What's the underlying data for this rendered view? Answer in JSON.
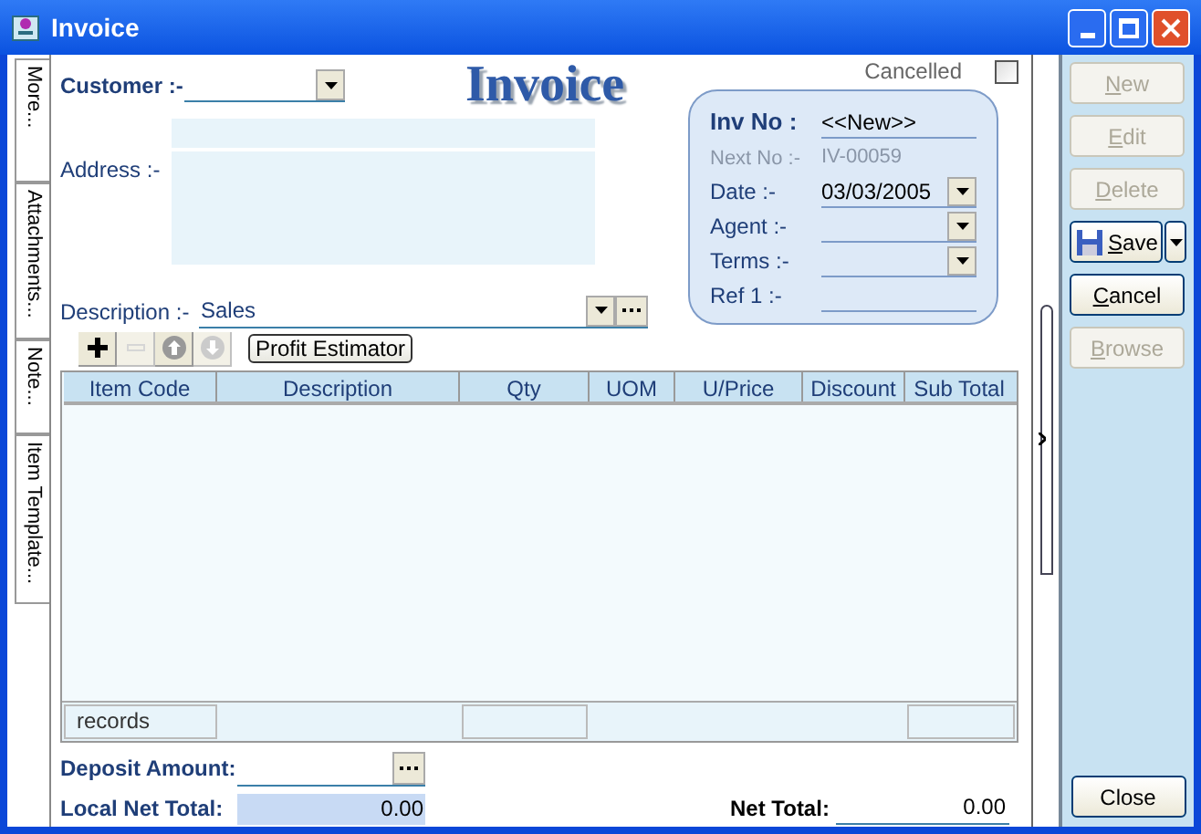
{
  "window": {
    "title": "Invoice"
  },
  "side_tabs": [
    {
      "label": "More..."
    },
    {
      "label": "Attachments..."
    },
    {
      "label": "Note..."
    },
    {
      "label": "Item Template..."
    }
  ],
  "heading": "Invoice",
  "customer": {
    "label": "Customer :-"
  },
  "address": {
    "label": "Address :-"
  },
  "description": {
    "label": "Description :-",
    "value": "Sales"
  },
  "cancelled": {
    "label": "Cancelled",
    "checked": false
  },
  "info_panel": {
    "inv_no": {
      "label": "Inv No :",
      "value": "<<New>>"
    },
    "next_no": {
      "label": "Next No :-",
      "value": "IV-00059"
    },
    "date": {
      "label": "Date :-",
      "value": "03/03/2005"
    },
    "agent": {
      "label": "Agent :-"
    },
    "terms": {
      "label": "Terms :-"
    },
    "ref_1": {
      "label": "Ref 1 :-"
    }
  },
  "grid_toolbar": [
    {
      "kind": "add",
      "disabled": false
    },
    {
      "kind": "remove",
      "disabled": true
    },
    {
      "kind": "up",
      "disabled": false
    },
    {
      "kind": "down",
      "disabled": true
    },
    {
      "kind": "text",
      "label": "Profit Estimator",
      "disabled": false
    }
  ],
  "grid": {
    "columns": [
      "Item Code",
      "Description",
      "Qty",
      "UOM",
      "U/Price",
      "Discount",
      "Sub Total"
    ],
    "footer": "records"
  },
  "deposit_amount": {
    "label": "Deposit Amount:"
  },
  "local_net_total": {
    "label": "Local Net Total:",
    "value": "0.00"
  },
  "net_total": {
    "label": "Net Total:",
    "value": "0.00"
  },
  "actions": [
    {
      "label": "New",
      "disabled": true
    },
    {
      "label": "Edit",
      "disabled": true
    },
    {
      "label": "Delete",
      "disabled": true
    },
    {
      "label": "Save",
      "disabled": false,
      "kind": "split"
    },
    {
      "label": "Cancel",
      "disabled": false
    },
    {
      "label": "Browse",
      "disabled": true
    }
  ],
  "close_button": "Close"
}
